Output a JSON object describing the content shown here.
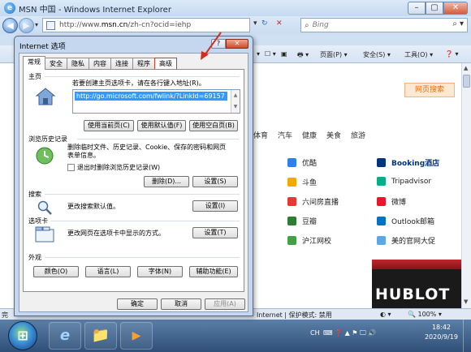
{
  "window": {
    "title": "MSN 中国 - Windows Internet Explorer",
    "min": "–",
    "max": "▢",
    "close": "✕"
  },
  "addressbar": {
    "url_prefix": "http://www.",
    "url_domain": "msn.cn",
    "url_rest": "/zh-cn?ocid=iehp",
    "search_placeholder": "Bing",
    "refresh": "↻",
    "stop": "✕",
    "nav_drop": "▾"
  },
  "commandbar": {
    "items": [
      "▾",
      "☐ ▾",
      "▣",
      "🖶 ▾",
      "页面(P) ▾",
      "安全(S) ▾",
      "工具(O) ▾",
      "❓ ▾"
    ]
  },
  "content": {
    "site_search": "网页搜索",
    "nav_links": [
      "体育",
      "汽车",
      "健康",
      "美食",
      "旅游"
    ],
    "col1": [
      "优酷",
      "斗鱼",
      "六间房直播",
      "豆瓣",
      "沪江网校"
    ],
    "col2": [
      "Booking酒店",
      "Tripadvisor",
      "微博",
      "Outlook邮箱",
      "美的官网大促"
    ],
    "col1_colors": [
      "#2f80ed",
      "#f2a900",
      "#e53935",
      "#2e7d32",
      "#43a047"
    ],
    "col2_colors": [
      "#003580",
      "#00af87",
      "#e6162d",
      "#0072c6",
      "#5aa9e6"
    ],
    "ad": "HUBLOT"
  },
  "statusbar": {
    "left": "完",
    "zone": "Internet | 保护模式: 禁用",
    "zoom": "🔍 100% ▾",
    "fav": "◐ ▾"
  },
  "taskbar": {
    "start": "⊞",
    "apps": [
      {
        "name": "ie",
        "glyph": "e"
      },
      {
        "name": "explorer",
        "glyph": "📁"
      },
      {
        "name": "media",
        "glyph": "▶"
      }
    ],
    "tray_lang": "CH",
    "tray_icons": "⌨ ❓ ▲ ⚑ 🖵 🔊",
    "time": "18:42",
    "date": "2020/9/19"
  },
  "dialog": {
    "title": "Internet 选项",
    "help": "?",
    "close": "✕",
    "tabs": [
      "常规",
      "安全",
      "隐私",
      "内容",
      "连接",
      "程序",
      "高级"
    ],
    "homepage": {
      "group": "主页",
      "desc": "若要创建主页选项卡，请在各行键入地址(R)。",
      "url": "http://go.microsoft.com/fwlink/?LinkId=69157",
      "btn_current": "使用当前页(C)",
      "btn_default": "使用默认值(F)",
      "btn_blank": "使用空白页(B)"
    },
    "history": {
      "group": "浏览历史记录",
      "desc1": "删除临时文件、历史记录、Cookie、保存的密码和网页",
      "desc2": "表单信息。",
      "checkbox": "退出时删除浏览历史记录(W)",
      "btn_delete": "删除(D)...",
      "btn_settings": "设置(S)"
    },
    "search": {
      "group": "搜索",
      "desc": "更改搜索默认值。",
      "btn_settings": "设置(I)"
    },
    "tabs_group": {
      "group": "选项卡",
      "desc": "更改网页在选项卡中显示的方式。",
      "btn_settings": "设置(T)"
    },
    "appearance": {
      "group": "外观",
      "btn_colors": "颜色(O)",
      "btn_languages": "语言(L)",
      "btn_fonts": "字体(N)",
      "btn_access": "辅助功能(E)"
    },
    "footer": {
      "ok": "确定",
      "cancel": "取消",
      "apply": "应用(A)"
    }
  }
}
